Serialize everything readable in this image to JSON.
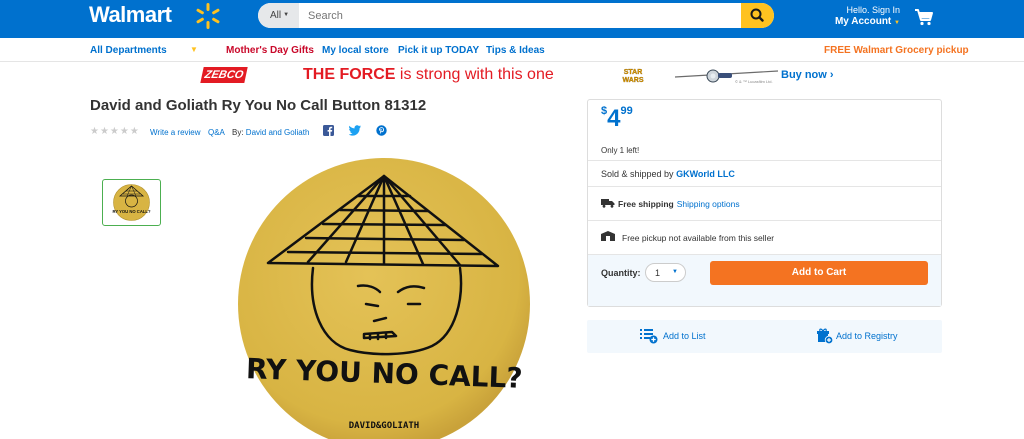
{
  "header": {
    "logo": "Walmart",
    "search": {
      "department": "All",
      "placeholder": "Search"
    },
    "account": {
      "greeting": "Hello. Sign In",
      "label": "My Account"
    }
  },
  "nav": {
    "departments": "All Departments",
    "links": [
      "Mother's Day Gifts",
      "My local store",
      "Pick it up TODAY",
      "Tips & Ideas"
    ],
    "promo": "FREE Walmart Grocery pickup"
  },
  "banner": {
    "brand": "ZEBCO",
    "headline_a": "THE FORCE",
    "headline_b": " is strong with this one",
    "sw_logo": "STAR WARS",
    "copyright": "© & ™ Lucasfilm Ltd.",
    "cta": "Buy now"
  },
  "product": {
    "title": "David and Goliath Ry You No Call Button 81312",
    "rating_stars": "★★★★★",
    "write_review": "Write a review",
    "qa": "Q&A",
    "by_label": "By:",
    "brand": "David and Goliath",
    "image_text": "RY YOU NO CALL?",
    "image_maker": "DAVID&GOLIATH"
  },
  "buybox": {
    "currency": "$",
    "price_dollars": "4",
    "price_cents": "99",
    "stock_note": "Only 1 left!",
    "sold_by_label": "Sold & shipped by ",
    "seller": "GKWorld LLC",
    "free_shipping": "Free shipping",
    "shipping_options": "Shipping options",
    "pickup_note": "Free pickup not available from this seller",
    "quantity_label": "Quantity:",
    "quantity_value": "1",
    "add_to_cart": "Add to Cart"
  },
  "actions": {
    "add_to_list": "Add to List",
    "add_to_registry": "Add to Registry"
  },
  "colors": {
    "brand_blue": "#0071ce",
    "spark_yellow": "#ffc220",
    "cart_orange": "#f47321",
    "gift_red": "#c9082a",
    "button_face": "#d8b443"
  }
}
